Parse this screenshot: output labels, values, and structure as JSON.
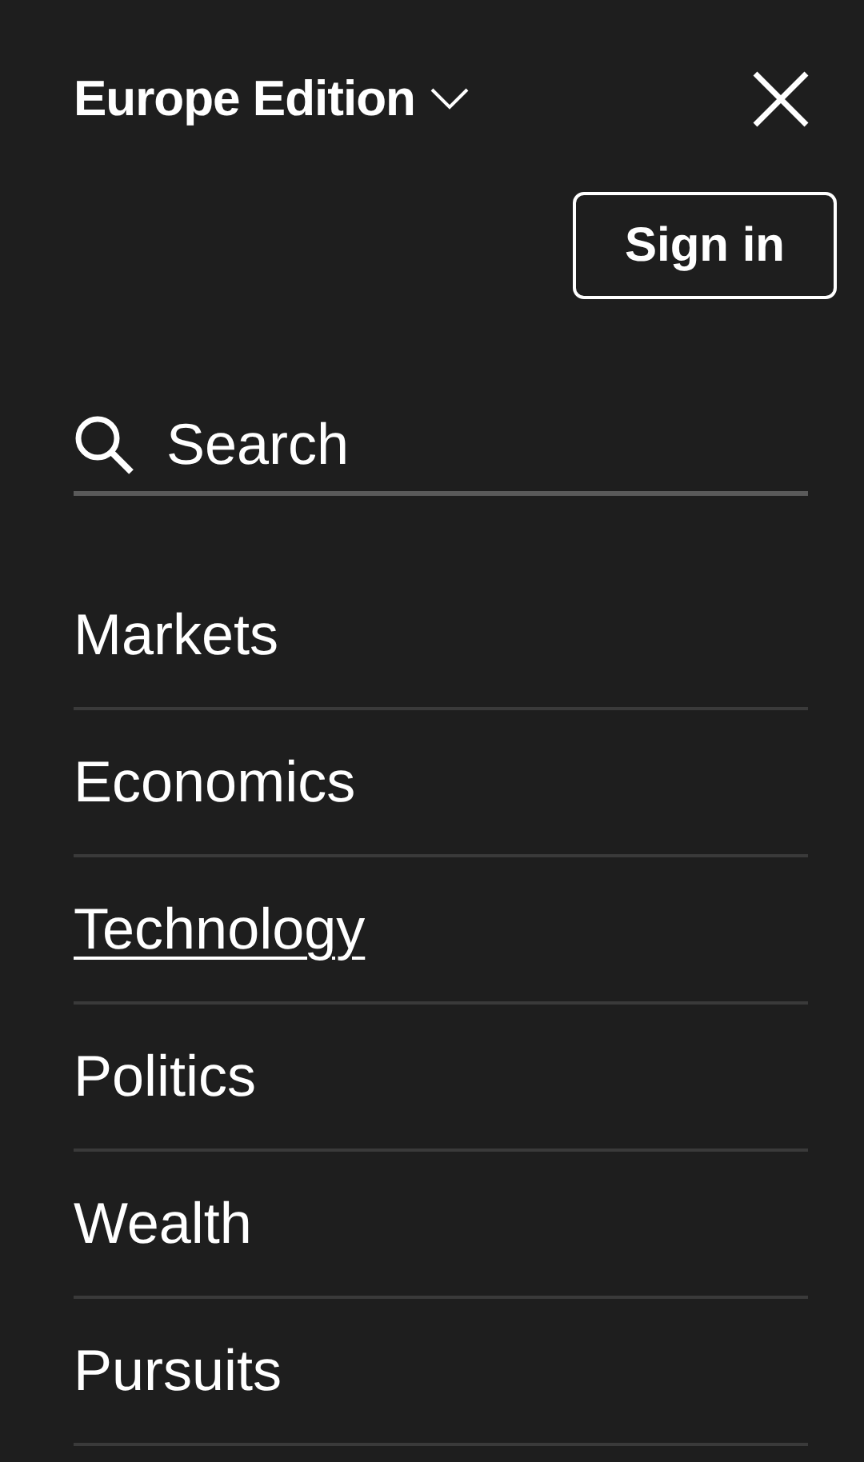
{
  "header": {
    "edition": "Europe Edition",
    "sign_in": "Sign in"
  },
  "search": {
    "placeholder": "Search"
  },
  "menu": [
    {
      "label": "Markets",
      "selected": false
    },
    {
      "label": "Economics",
      "selected": false
    },
    {
      "label": "Technology",
      "selected": true
    },
    {
      "label": "Politics",
      "selected": false
    },
    {
      "label": "Wealth",
      "selected": false
    },
    {
      "label": "Pursuits",
      "selected": false
    }
  ]
}
